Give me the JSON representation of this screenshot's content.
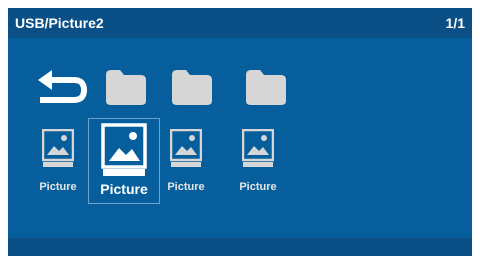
{
  "header": {
    "path": "USB/Picture2",
    "page": "1/1"
  },
  "grid": {
    "back_icon": "back-arrow-icon",
    "folders": [
      "folder-icon",
      "folder-icon",
      "folder-icon"
    ],
    "pictures": [
      {
        "label": "Picture",
        "icon": "image-icon",
        "selected": false
      },
      {
        "label": "Picture",
        "icon": "image-icon",
        "selected": true
      },
      {
        "label": "Picture",
        "icon": "image-icon",
        "selected": false
      },
      {
        "label": "Picture",
        "icon": "image-icon",
        "selected": false
      }
    ]
  },
  "colors": {
    "background": "#065f9c",
    "bar": "#0a4f86",
    "icon": "#d6d6d6",
    "selected_icon": "#ffffff"
  }
}
